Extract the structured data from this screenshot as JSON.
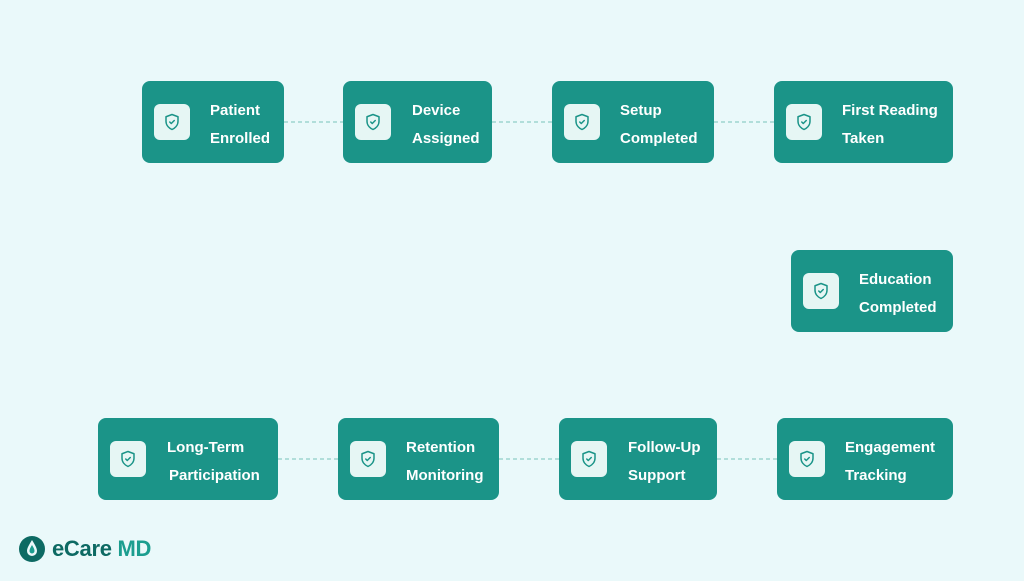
{
  "diagram": {
    "nodes": [
      {
        "id": "patient-enrolled",
        "line1": "Patient",
        "line2": "Enrolled",
        "icon": "shield-check-icon"
      },
      {
        "id": "device-assigned",
        "line1": "Device",
        "line2": "Assigned",
        "icon": "shield-check-icon"
      },
      {
        "id": "setup-completed",
        "line1": "Setup",
        "line2": "Completed",
        "icon": "shield-check-icon"
      },
      {
        "id": "first-reading-taken",
        "line1": "First Reading",
        "line2": "Taken",
        "icon": "shield-check-icon"
      },
      {
        "id": "education-completed",
        "line1": "Education",
        "line2": "Completed",
        "icon": "shield-check-icon"
      },
      {
        "id": "long-term-participation",
        "line1": "Long-Term",
        "line2": "Participation",
        "icon": "shield-check-icon"
      },
      {
        "id": "retention-monitoring",
        "line1": "Retention",
        "line2": "Monitoring",
        "icon": "shield-check-icon"
      },
      {
        "id": "follow-up-support",
        "line1": "Follow-Up",
        "line2": "Support",
        "icon": "shield-check-icon"
      },
      {
        "id": "engagement-tracking",
        "line1": "Engagement",
        "line2": "Tracking",
        "icon": "shield-check-icon"
      }
    ],
    "edges": [
      [
        "patient-enrolled",
        "device-assigned"
      ],
      [
        "device-assigned",
        "setup-completed"
      ],
      [
        "setup-completed",
        "first-reading-taken"
      ],
      [
        "long-term-participation",
        "retention-monitoring"
      ],
      [
        "retention-monitoring",
        "follow-up-support"
      ],
      [
        "follow-up-support",
        "engagement-tracking"
      ]
    ]
  },
  "brand": {
    "logo_prefix": "eCare",
    "logo_suffix": "MD"
  },
  "colors": {
    "background": "#eaf9fa",
    "node": "#1b9488",
    "icon_tile": "#e6f6f4",
    "connector": "#8fcfc7",
    "brand_dark": "#0d6a63",
    "brand_light": "#1b9e8f"
  }
}
